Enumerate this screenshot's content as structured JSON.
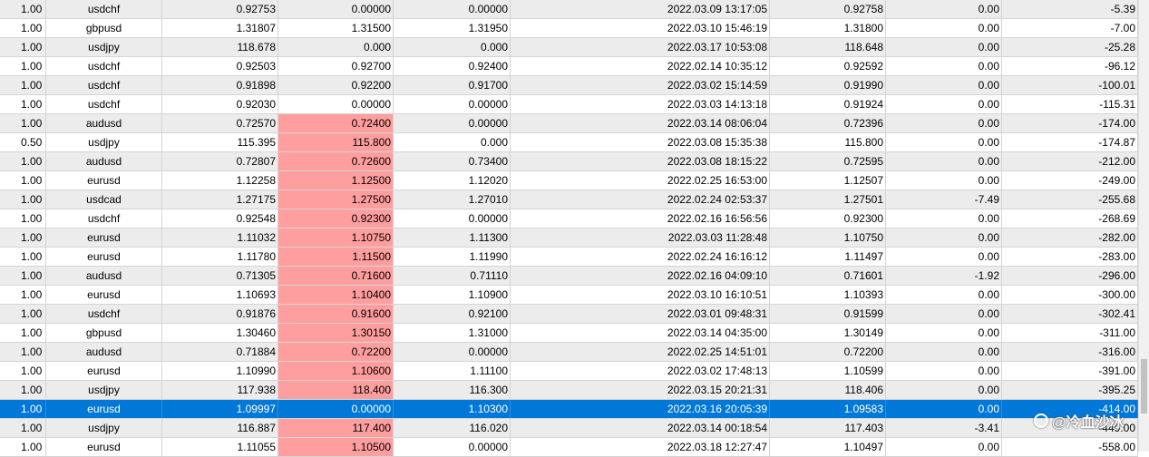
{
  "table": {
    "rows": [
      {
        "cells": [
          "1.00",
          "usdchf",
          "0.92753",
          "0.00000",
          "0.00000",
          "2022.03.09 13:17:05",
          "0.92758",
          "0.00",
          "-5.39"
        ],
        "highlight": false,
        "selected": false
      },
      {
        "cells": [
          "1.00",
          "gbpusd",
          "1.31807",
          "1.31500",
          "1.31950",
          "2022.03.10 15:46:19",
          "1.31800",
          "0.00",
          "-7.00"
        ],
        "highlight": false,
        "selected": false
      },
      {
        "cells": [
          "1.00",
          "usdjpy",
          "118.678",
          "0.000",
          "0.000",
          "2022.03.17 10:53:08",
          "118.648",
          "0.00",
          "-25.28"
        ],
        "highlight": false,
        "selected": false
      },
      {
        "cells": [
          "1.00",
          "usdchf",
          "0.92503",
          "0.92700",
          "0.92400",
          "2022.02.14 10:35:12",
          "0.92592",
          "0.00",
          "-96.12"
        ],
        "highlight": false,
        "selected": false
      },
      {
        "cells": [
          "1.00",
          "usdchf",
          "0.91898",
          "0.92200",
          "0.91700",
          "2022.03.02 15:14:59",
          "0.91990",
          "0.00",
          "-100.01"
        ],
        "highlight": false,
        "selected": false
      },
      {
        "cells": [
          "1.00",
          "usdchf",
          "0.92030",
          "0.00000",
          "0.00000",
          "2022.03.03 14:13:18",
          "0.91924",
          "0.00",
          "-115.31"
        ],
        "highlight": false,
        "selected": false
      },
      {
        "cells": [
          "1.00",
          "audusd",
          "0.72570",
          "0.72400",
          "0.00000",
          "2022.03.14 08:06:04",
          "0.72396",
          "0.00",
          "-174.00"
        ],
        "highlight": true,
        "selected": false
      },
      {
        "cells": [
          "0.50",
          "usdjpy",
          "115.395",
          "115.800",
          "0.000",
          "2022.03.08 15:35:38",
          "115.800",
          "0.00",
          "-174.87"
        ],
        "highlight": true,
        "selected": false
      },
      {
        "cells": [
          "1.00",
          "audusd",
          "0.72807",
          "0.72600",
          "0.73400",
          "2022.03.08 18:15:22",
          "0.72595",
          "0.00",
          "-212.00"
        ],
        "highlight": true,
        "selected": false
      },
      {
        "cells": [
          "1.00",
          "eurusd",
          "1.12258",
          "1.12500",
          "1.12020",
          "2022.02.25 16:53:00",
          "1.12507",
          "0.00",
          "-249.00"
        ],
        "highlight": true,
        "selected": false
      },
      {
        "cells": [
          "1.00",
          "usdcad",
          "1.27175",
          "1.27500",
          "1.27010",
          "2022.02.24 02:53:37",
          "1.27501",
          "-7.49",
          "-255.68"
        ],
        "highlight": true,
        "selected": false
      },
      {
        "cells": [
          "1.00",
          "usdchf",
          "0.92548",
          "0.92300",
          "0.00000",
          "2022.02.16 16:56:56",
          "0.92300",
          "0.00",
          "-268.69"
        ],
        "highlight": true,
        "selected": false
      },
      {
        "cells": [
          "1.00",
          "eurusd",
          "1.11032",
          "1.10750",
          "1.11300",
          "2022.03.03 11:28:48",
          "1.10750",
          "0.00",
          "-282.00"
        ],
        "highlight": true,
        "selected": false
      },
      {
        "cells": [
          "1.00",
          "eurusd",
          "1.11780",
          "1.11500",
          "1.11990",
          "2022.02.24 16:16:12",
          "1.11497",
          "0.00",
          "-283.00"
        ],
        "highlight": true,
        "selected": false
      },
      {
        "cells": [
          "1.00",
          "audusd",
          "0.71305",
          "0.71600",
          "0.71110",
          "2022.02.16 04:09:10",
          "0.71601",
          "-1.92",
          "-296.00"
        ],
        "highlight": true,
        "selected": false
      },
      {
        "cells": [
          "1.00",
          "eurusd",
          "1.10693",
          "1.10400",
          "1.10900",
          "2022.03.10 16:10:51",
          "1.10393",
          "0.00",
          "-300.00"
        ],
        "highlight": true,
        "selected": false
      },
      {
        "cells": [
          "1.00",
          "usdchf",
          "0.91876",
          "0.91600",
          "0.92100",
          "2022.03.01 09:48:31",
          "0.91599",
          "0.00",
          "-302.41"
        ],
        "highlight": true,
        "selected": false
      },
      {
        "cells": [
          "1.00",
          "gbpusd",
          "1.30460",
          "1.30150",
          "1.31000",
          "2022.03.14 04:35:00",
          "1.30149",
          "0.00",
          "-311.00"
        ],
        "highlight": true,
        "selected": false
      },
      {
        "cells": [
          "1.00",
          "audusd",
          "0.71884",
          "0.72200",
          "0.00000",
          "2022.02.25 14:51:01",
          "0.72200",
          "0.00",
          "-316.00"
        ],
        "highlight": true,
        "selected": false
      },
      {
        "cells": [
          "1.00",
          "eurusd",
          "1.10990",
          "1.10600",
          "1.11100",
          "2022.03.02 17:48:13",
          "1.10599",
          "0.00",
          "-391.00"
        ],
        "highlight": true,
        "selected": false
      },
      {
        "cells": [
          "1.00",
          "usdjpy",
          "117.938",
          "118.400",
          "116.300",
          "2022.03.15 20:21:31",
          "118.406",
          "0.00",
          "-395.25"
        ],
        "highlight": true,
        "selected": false
      },
      {
        "cells": [
          "1.00",
          "eurusd",
          "1.09997",
          "0.00000",
          "1.10300",
          "2022.03.16 20:05:39",
          "1.09583",
          "0.00",
          "-414.00"
        ],
        "highlight": false,
        "selected": true
      },
      {
        "cells": [
          "1.00",
          "usdjpy",
          "116.887",
          "117.400",
          "116.020",
          "2022.03.14 00:18:54",
          "117.403",
          "-3.41",
          "-449.00"
        ],
        "highlight": true,
        "selected": false
      },
      {
        "cells": [
          "1.00",
          "eurusd",
          "1.11055",
          "1.10500",
          "0.00000",
          "2022.03.18 12:27:47",
          "1.10497",
          "0.00",
          "-558.00"
        ],
        "highlight": true,
        "selected": false
      }
    ]
  },
  "watermark": {
    "text": "@冷血沙冰",
    "icon": "watermark-circle-icon"
  },
  "colors": {
    "highlight": "#ff9e9e",
    "selected": "#0078d7",
    "alt_row": "#ececec"
  }
}
